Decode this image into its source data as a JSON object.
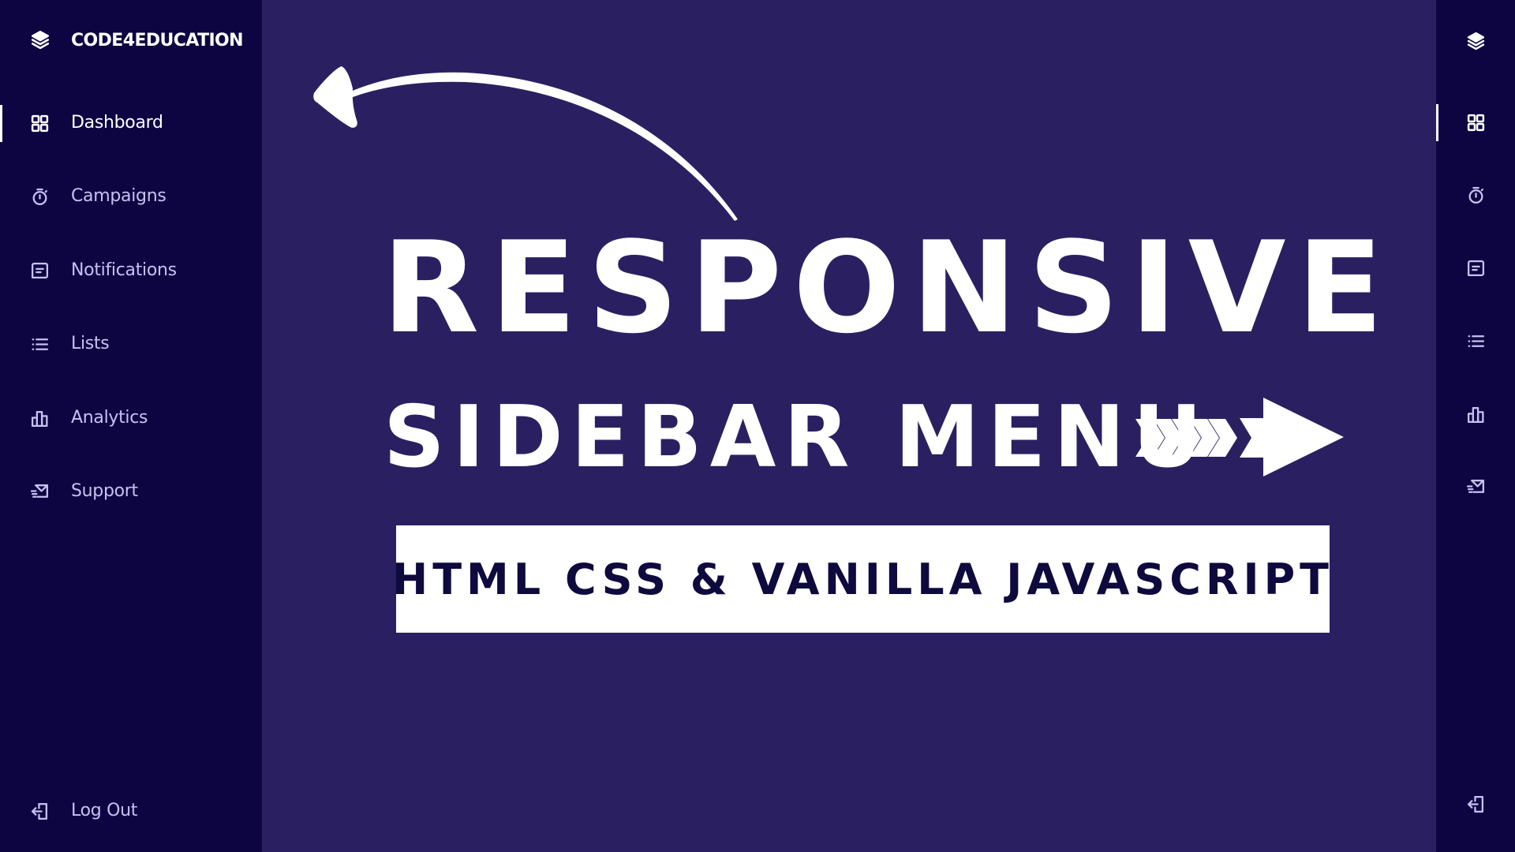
{
  "brand": {
    "name": "CODE4EDUCATION",
    "icon": "layers-icon"
  },
  "sidebar": {
    "items": [
      {
        "label": "Dashboard",
        "icon": "grid-icon",
        "active": true
      },
      {
        "label": "Campaigns",
        "icon": "stopwatch-icon",
        "active": false
      },
      {
        "label": "Notifications",
        "icon": "message-square-icon",
        "active": false
      },
      {
        "label": "Lists",
        "icon": "list-icon",
        "active": false
      },
      {
        "label": "Analytics",
        "icon": "bar-chart-icon",
        "active": false
      },
      {
        "label": "Support",
        "icon": "mail-send-icon",
        "active": false
      }
    ],
    "logout": {
      "label": "Log Out",
      "icon": "logout-icon"
    }
  },
  "main": {
    "headline": "RESPONSIVE",
    "subheadline": "SIDEBAR MENU",
    "tagline": "HTML CSS & VANILLA JAVASCRIPT"
  },
  "colors": {
    "sidebar_bg": "#0c0541",
    "main_bg": "#2a2061",
    "active_text": "#ffffff",
    "inactive_text": "#c9c0f2",
    "tagline_text": "#0e0a3d"
  }
}
